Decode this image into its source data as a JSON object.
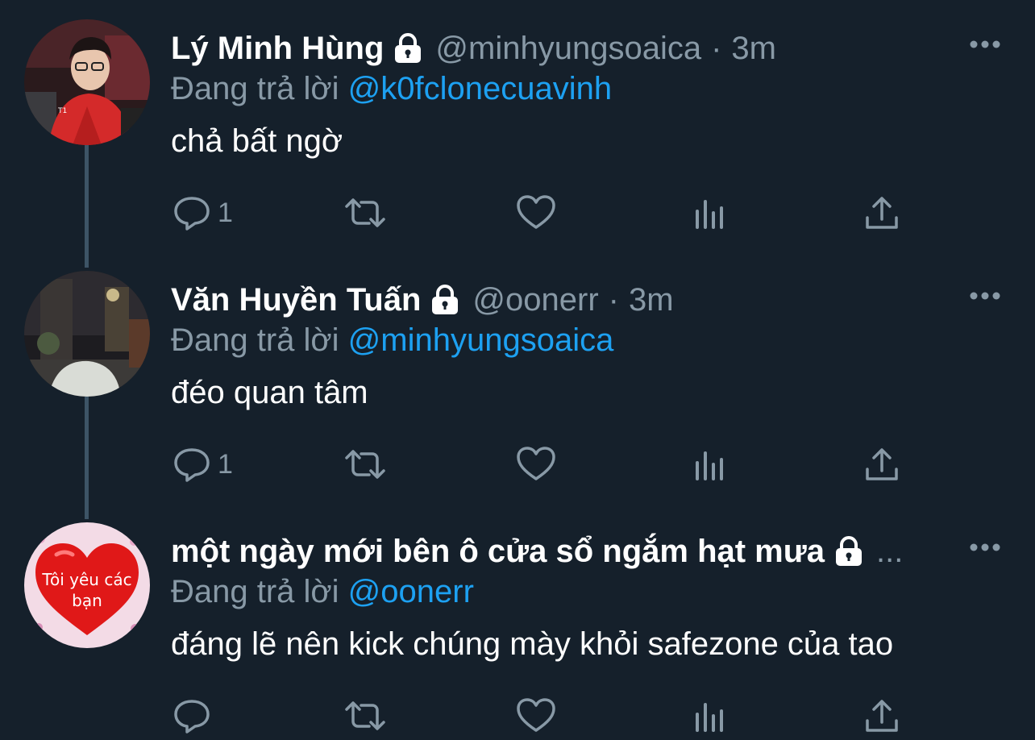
{
  "colors": {
    "background": "#15202b",
    "text_primary": "#ffffff",
    "text_secondary": "#8899a6",
    "accent": "#1da1f2",
    "thread_line": "#3d5466"
  },
  "tweets": [
    {
      "name": "Lý Minh Hùng",
      "handle": "@minhyungsoaica",
      "separator": "·",
      "time": "3m",
      "replying_prefix": "Đang trả lời",
      "replying_to": "@k0fclonecuavinh",
      "text": "chả bất ngờ",
      "reply_count": "1",
      "locked_icon": "lock-icon",
      "avatar": "avatar-photo-red-jersey"
    },
    {
      "name": "Văn Huyền Tuấn",
      "handle": "@oonerr",
      "separator": "·",
      "time": "3m",
      "replying_prefix": "Đang trả lời",
      "replying_to": "@minhyungsoaica",
      "text": "đéo quan tâm",
      "reply_count": "1",
      "locked_icon": "lock-icon",
      "avatar": "avatar-photo-night-street"
    },
    {
      "name": "một ngày mới bên ô cửa sổ ngắm hạt mưa",
      "ellipsis": "...",
      "replying_prefix": "Đang trả lời",
      "replying_to": "@oonerr",
      "text": "đáng lẽ nên kick chúng mày khỏi safezone của tao",
      "reply_count": "",
      "locked_icon": "lock-icon",
      "avatar": "avatar-red-heart",
      "avatar_text": "Tôi yêu các bạn"
    }
  ]
}
